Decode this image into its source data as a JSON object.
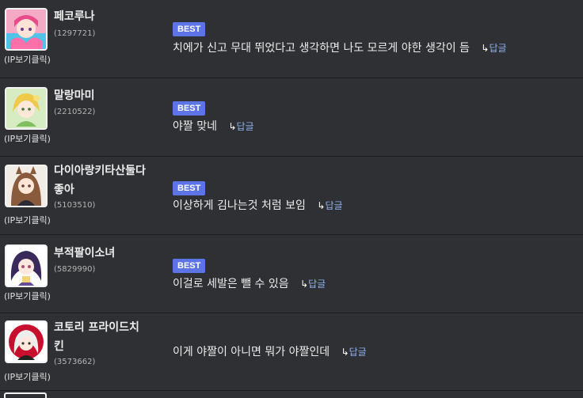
{
  "comments": [
    {
      "nickname": "페코루나",
      "user_id": "(1297721)",
      "ip_label": "(IP보기클릭)",
      "best": "BEST",
      "text": "치에가 신고 무대 뛰었다고 생각하면 나도 모르게 야한 생각이 듬",
      "reply_arrow": "↳",
      "reply_label": "답글",
      "avatar_icon": "anime-girl-pink-avatar"
    },
    {
      "nickname": "말랑마미",
      "user_id": "(2210522)",
      "ip_label": "(IP보기클릭)",
      "best": "BEST",
      "text": "야짤 맞네",
      "reply_arrow": "↳",
      "reply_label": "답글",
      "avatar_icon": "anime-girl-blonde-avatar"
    },
    {
      "nickname": "다이아랑키타산둘다좋아",
      "nickname_line1": "다이아랑키타산둘다",
      "nickname_line2": "좋아",
      "user_id": "(5103510)",
      "ip_label": "(IP보기클릭)",
      "best": "BEST",
      "text": "이상하게 김나는것 처럼 보임",
      "reply_arrow": "↳",
      "reply_label": "답글",
      "avatar_icon": "anime-girl-horse-ears-avatar"
    },
    {
      "nickname": "부적팔이소녀",
      "user_id": "(5829990)",
      "ip_label": "(IP보기클릭)",
      "best": "BEST",
      "text": "이걸로 세발은 뺄 수 있음",
      "reply_arrow": "↳",
      "reply_label": "답글",
      "avatar_icon": "anime-girl-purple-hair-avatar"
    },
    {
      "nickname": "코토리 프라이드치킨",
      "nickname_line1": "코토리 프라이드치",
      "nickname_line2": "킨",
      "user_id": "(3573662)",
      "ip_label": "(IP보기클릭)",
      "best": "",
      "text": "이게 야짤이 아니면 뭐가 야짤인데",
      "reply_arrow": "↳",
      "reply_label": "답글",
      "avatar_icon": "kfc-colonel-girl-avatar"
    }
  ]
}
